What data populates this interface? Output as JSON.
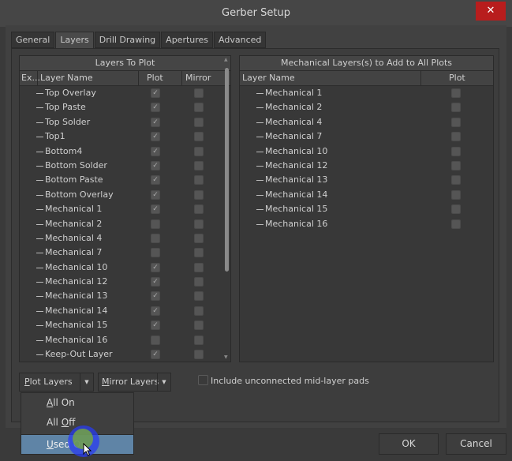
{
  "window": {
    "title": "Gerber Setup",
    "close_label": "✕"
  },
  "tabs": [
    {
      "label": "General",
      "active": false
    },
    {
      "label": "Layers",
      "active": true
    },
    {
      "label": "Drill Drawing",
      "active": false
    },
    {
      "label": "Apertures",
      "active": false
    },
    {
      "label": "Advanced",
      "active": false
    }
  ],
  "left_panel": {
    "title": "Layers To Plot",
    "columns": {
      "expand": "Ex...",
      "name": "Layer Name",
      "plot": "Plot",
      "mirror": "Mirror"
    },
    "rows": [
      {
        "name": "Top Overlay",
        "plot": true,
        "mirror": false
      },
      {
        "name": "Top Paste",
        "plot": true,
        "mirror": false
      },
      {
        "name": "Top Solder",
        "plot": true,
        "mirror": false
      },
      {
        "name": "Top1",
        "plot": true,
        "mirror": false
      },
      {
        "name": "Bottom4",
        "plot": true,
        "mirror": false
      },
      {
        "name": "Bottom Solder",
        "plot": true,
        "mirror": false
      },
      {
        "name": "Bottom Paste",
        "plot": true,
        "mirror": false
      },
      {
        "name": "Bottom Overlay",
        "plot": true,
        "mirror": false
      },
      {
        "name": "Mechanical 1",
        "plot": true,
        "mirror": false
      },
      {
        "name": "Mechanical 2",
        "plot": false,
        "mirror": false
      },
      {
        "name": "Mechanical 4",
        "plot": false,
        "mirror": false
      },
      {
        "name": "Mechanical 7",
        "plot": false,
        "mirror": false
      },
      {
        "name": "Mechanical 10",
        "plot": true,
        "mirror": false
      },
      {
        "name": "Mechanical 12",
        "plot": true,
        "mirror": false
      },
      {
        "name": "Mechanical 13",
        "plot": true,
        "mirror": false
      },
      {
        "name": "Mechanical 14",
        "plot": true,
        "mirror": false
      },
      {
        "name": "Mechanical 15",
        "plot": true,
        "mirror": false
      },
      {
        "name": "Mechanical 16",
        "plot": false,
        "mirror": false
      },
      {
        "name": "Keep-Out Layer",
        "plot": true,
        "mirror": false
      }
    ]
  },
  "right_panel": {
    "title": "Mechanical Layers(s) to Add to All Plots",
    "columns": {
      "name": "Layer Name",
      "plot": "Plot"
    },
    "rows": [
      {
        "name": "Mechanical 1",
        "plot": false
      },
      {
        "name": "Mechanical 2",
        "plot": false
      },
      {
        "name": "Mechanical 4",
        "plot": false
      },
      {
        "name": "Mechanical 7",
        "plot": false
      },
      {
        "name": "Mechanical 10",
        "plot": false
      },
      {
        "name": "Mechanical 12",
        "plot": false
      },
      {
        "name": "Mechanical 13",
        "plot": false
      },
      {
        "name": "Mechanical 14",
        "plot": false
      },
      {
        "name": "Mechanical 15",
        "plot": false
      },
      {
        "name": "Mechanical 16",
        "plot": false
      }
    ]
  },
  "controls": {
    "plot_layers": {
      "pre": "",
      "u": "P",
      "post": "lot Layers"
    },
    "mirror_layers": {
      "pre": "",
      "u": "M",
      "post": "irror Layers"
    },
    "include_pads_label": "Include unconnected mid-layer pads",
    "include_pads_checked": false
  },
  "menu": {
    "items": [
      {
        "pre": "",
        "u": "A",
        "post": "ll On",
        "selected": false
      },
      {
        "pre": "All ",
        "u": "O",
        "post": "ff",
        "selected": false
      },
      {
        "pre": "",
        "u": "U",
        "post": "sed On",
        "selected": true
      }
    ]
  },
  "buttons": {
    "ok": "OK",
    "cancel": "Cancel"
  },
  "icons": {
    "check": "✓",
    "dropdown": "▼",
    "scroll_up": "▲",
    "scroll_down": "▼"
  }
}
